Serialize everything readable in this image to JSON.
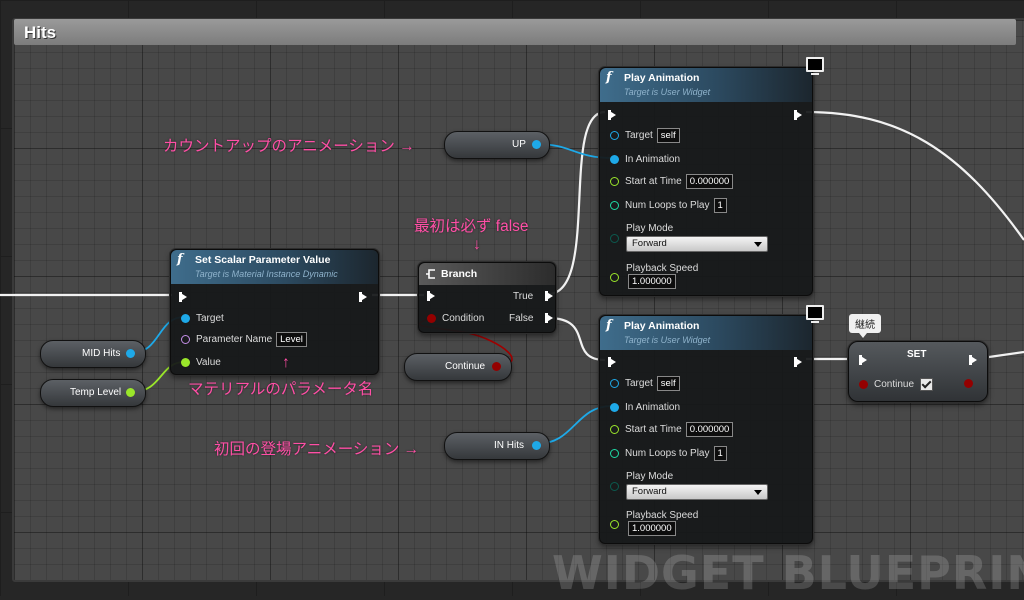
{
  "comment": {
    "title": "Hits"
  },
  "watermark": "WIDGET BLUEPRINT",
  "nodes": {
    "set_scalar": {
      "title": "Set Scalar Parameter Value",
      "subtitle": "Target is Material Instance Dynamic",
      "target_label": "Target",
      "param_name_label": "Parameter Name",
      "param_name_value": "Level",
      "value_label": "Value"
    },
    "branch": {
      "title": "Branch",
      "true_label": "True",
      "false_label": "False",
      "condition_label": "Condition"
    },
    "play_anim_1": {
      "title": "Play Animation",
      "subtitle": "Target is User Widget",
      "target_label": "Target",
      "target_value": "self",
      "in_animation_label": "In Animation",
      "start_at_time_label": "Start at Time",
      "start_at_time_value": "0.000000",
      "num_loops_label": "Num Loops to Play",
      "num_loops_value": "1",
      "play_mode_label": "Play Mode",
      "play_mode_value": "Forward",
      "playback_speed_label": "Playback Speed",
      "playback_speed_value": "1.000000"
    },
    "play_anim_2": {
      "title": "Play Animation",
      "subtitle": "Target is User Widget",
      "target_label": "Target",
      "target_value": "self",
      "in_animation_label": "In Animation",
      "start_at_time_label": "Start at Time",
      "start_at_time_value": "0.000000",
      "num_loops_label": "Num Loops to Play",
      "num_loops_value": "1",
      "play_mode_label": "Play Mode",
      "play_mode_value": "Forward",
      "playback_speed_label": "Playback Speed",
      "playback_speed_value": "1.000000"
    },
    "set_node": {
      "title": "SET",
      "continue_label": "Continue",
      "continue_checked": true,
      "tag": "継続"
    }
  },
  "variables": {
    "up": "UP",
    "in_hits": "IN Hits",
    "mid_hits": "MID Hits",
    "temp_level": "Temp Level",
    "continue": "Continue"
  },
  "annotations": {
    "countup": "カウントアップのアニメーション →",
    "first_false": "最初は必ず false",
    "first_false_arrow": "↓",
    "param_arrow": "↑",
    "param_name": "マテリアルのパラメータ名",
    "first_appear": "初回の登場アニメーション →"
  },
  "colors": {
    "object_pin": "#1ea9e8",
    "float_pin": "#9ae62a",
    "name_pin": "#c48ee8",
    "int_pin": "#1ed9a5",
    "byte_pin": "#0b5a4e",
    "bool_pin": "#940000",
    "annotation": "#ff4fa6"
  },
  "icons": {
    "function": "function-f-icon",
    "branch": "branch-icon",
    "monitor": "monitor-icon"
  }
}
